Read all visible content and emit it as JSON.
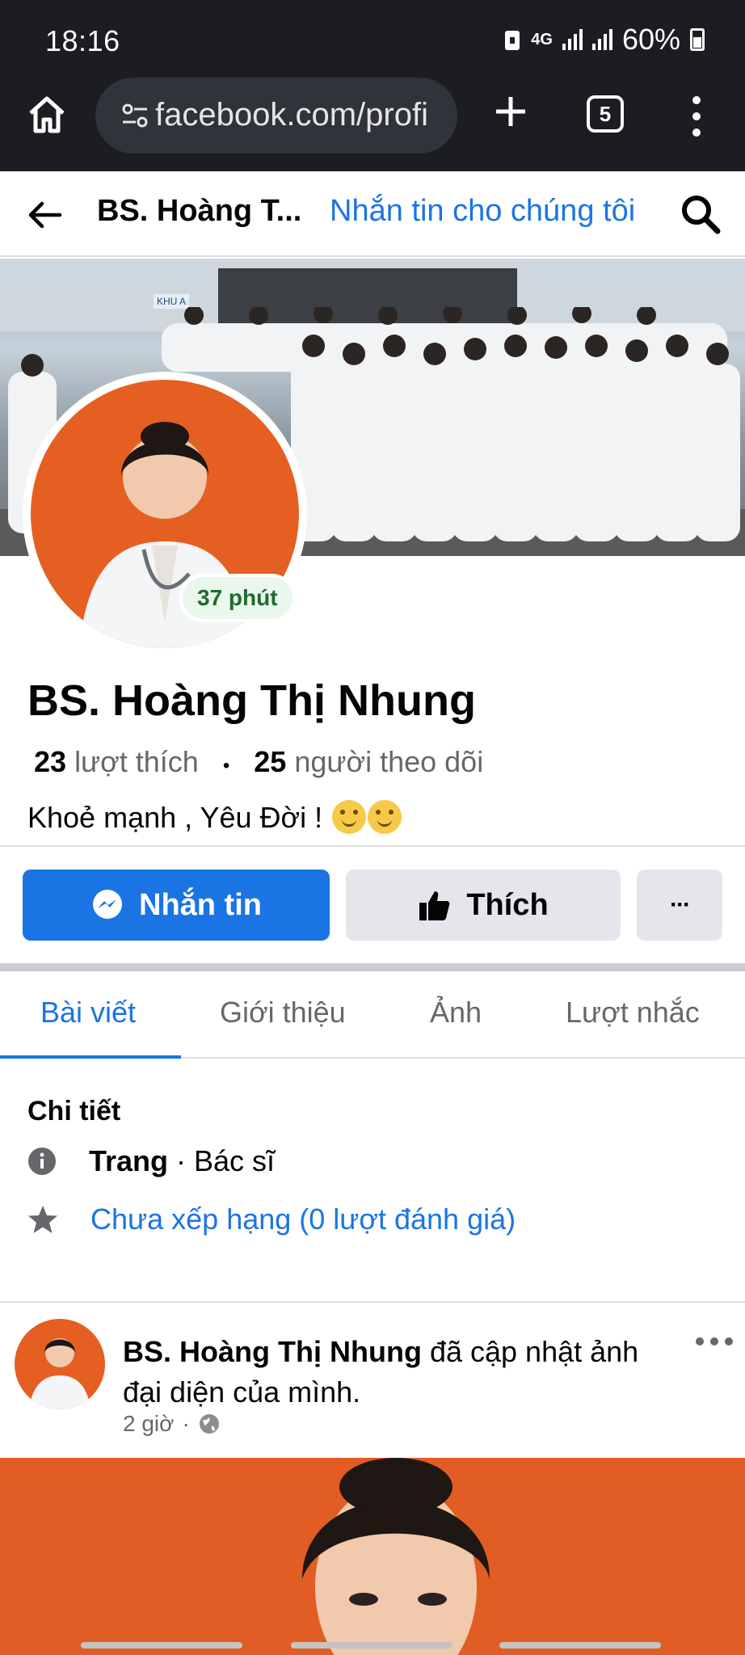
{
  "status_bar": {
    "time": "18:16",
    "network": "4G",
    "battery": "60%"
  },
  "browser": {
    "url": "facebook.com/profi",
    "tab_count": "5"
  },
  "fb_header": {
    "page_name_short": "BS. Hoàng T...",
    "message_link": "Nhắn tin cho chúng tôi"
  },
  "profile": {
    "name": "BS. Hoàng Thị Nhung",
    "likes_count": "23",
    "likes_label": "lượt thích",
    "followers_count": "25",
    "followers_label": "người theo dõi",
    "bio": "Khoẻ mạnh , Yêu Đời !",
    "story_time": "37 phút",
    "cover_sign": "KHU A"
  },
  "actions": {
    "message": "Nhắn tin",
    "like": "Thích",
    "more": "···"
  },
  "tabs": [
    "Bài viết",
    "Giới thiệu",
    "Ảnh",
    "Lượt nhắc"
  ],
  "details": {
    "title": "Chi tiết",
    "category_label": "Trang",
    "category_value": "· Bác sĩ",
    "rating": "Chưa xếp hạng (0 lượt đánh giá)"
  },
  "post": {
    "author": "BS. Hoàng Thị Nhung",
    "action_text": " đã cập nhật ảnh đại diện của mình.",
    "time": "2 giờ",
    "separator": "·"
  },
  "colors": {
    "fb_blue": "#1b74e4",
    "chrome_dark": "#1b1d21",
    "avatar_orange": "#e55f22"
  }
}
